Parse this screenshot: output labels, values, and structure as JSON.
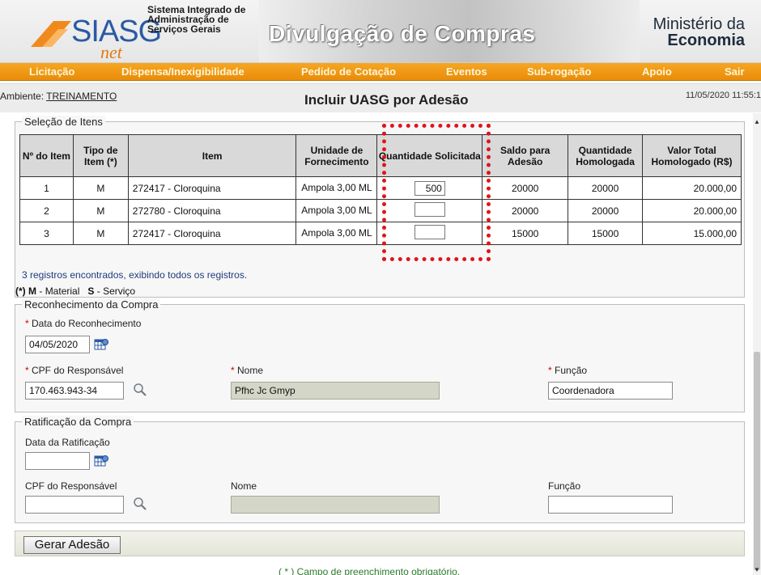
{
  "header": {
    "logo_main": "SIASG",
    "logo_sub": "net",
    "system_name": "Sistema Integrado de Administração de Serviços Gerais",
    "banner_title": "Divulgação de Compras",
    "ministry_line1": "Ministério da",
    "ministry_line2": "Economia"
  },
  "nav": {
    "items": [
      "Licitação",
      "Dispensa/Inexigibilidade",
      "Pedido de Cotação",
      "Eventos",
      "Sub-rogação",
      "Apoio",
      "Sair"
    ],
    "background": "#f39c12"
  },
  "ambient": {
    "label": "Ambiente:",
    "value": "TREINAMENTO",
    "page_title": "Incluir UASG por Adesão",
    "datetime": "11/05/2020 11:55:1"
  },
  "items_section": {
    "legend": "Seleção de Itens",
    "columns": [
      "Nº do Item",
      "Tipo de Item (*)",
      "Item",
      "Unidade de Fornecimento",
      "Quantidade Solicitada",
      "Saldo para Adesão",
      "Quantidade Homologada",
      "Valor Total Homologado (R$)"
    ],
    "rows": [
      {
        "num": "1",
        "tipo": "M",
        "item": "272417 - Cloroquina",
        "unidade": "Ampola 3,00 ML",
        "quantidade": "500",
        "saldo": "20000",
        "homologada": "20000",
        "valor": "20.000,00"
      },
      {
        "num": "2",
        "tipo": "M",
        "item": "272780 - Cloroquina",
        "unidade": "Ampola 3,00 ML",
        "quantidade": "",
        "saldo": "20000",
        "homologada": "20000",
        "valor": "20.000,00"
      },
      {
        "num": "3",
        "tipo": "M",
        "item": "272417 - Cloroquina",
        "unidade": "Ampola 3,00 ML",
        "quantidade": "",
        "saldo": "15000",
        "homologada": "15000",
        "valor": "15.000,00"
      }
    ],
    "records_text": "3 registros encontrados, exibindo todos os registros.",
    "legend_key_prefix": "(*)",
    "legend_key_m": "M",
    "legend_key_m_text": "- Material",
    "legend_key_s": "S",
    "legend_key_s_text": "- Serviço"
  },
  "reconhecimento": {
    "legend": "Reconhecimento da Compra",
    "date_label": "Data do Reconhecimento",
    "date_value": "04/05/2020",
    "cpf_label": "CPF do Responsável",
    "cpf_value": "170.463.943-34",
    "nome_label": "Nome",
    "nome_value": "Pfhc Jc Gmyp",
    "funcao_label": "Função",
    "funcao_value": "Coordenadora",
    "required_mark": "*"
  },
  "ratificacao": {
    "legend": "Ratificação da Compra",
    "date_label": "Data da Ratificação",
    "date_value": "",
    "cpf_label": "CPF do Responsável",
    "cpf_value": "",
    "nome_label": "Nome",
    "nome_value": "",
    "funcao_label": "Função",
    "funcao_value": ""
  },
  "actions": {
    "gerar_label": "Gerar Adesão"
  },
  "footer": {
    "note": "( * ) Campo de preenchimento obrigatório."
  },
  "colors": {
    "nav_orange": "#f39c12",
    "highlight_red": "#e0141c",
    "readonly_field": "#d4d7c8",
    "footer_green": "#2b7a2b"
  }
}
